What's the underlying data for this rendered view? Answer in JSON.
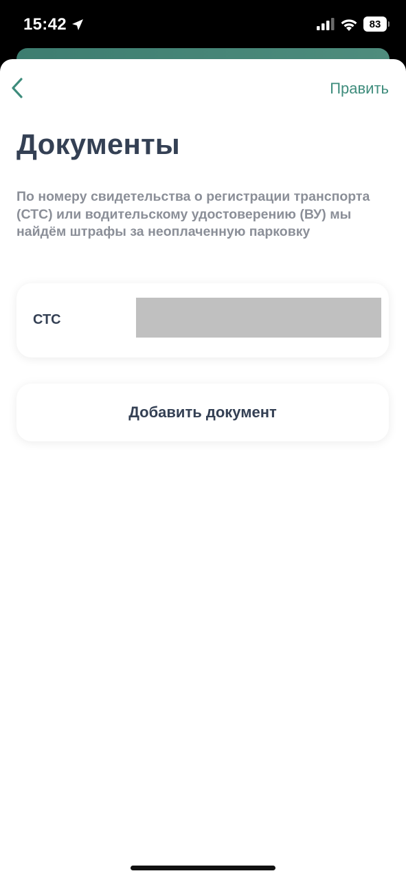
{
  "status_bar": {
    "time": "15:42",
    "battery": "83",
    "icons": [
      "location-arrow-icon",
      "cellular-signal-icon",
      "wifi-icon",
      "battery-icon"
    ]
  },
  "nav": {
    "back_icon": "chevron-left-icon",
    "edit_label": "Править"
  },
  "page": {
    "title": "Документы",
    "description": "По номеру свидетельства о регистрации транспорта (СТС) или водительскому удостоверению (ВУ) мы найдём штрафы за неоплаченную парковку"
  },
  "documents": [
    {
      "label": "СТС",
      "value": ""
    }
  ],
  "add_document_label": "Добавить документ",
  "colors": {
    "accent": "#3e8c7c",
    "title": "#344054",
    "description": "#8b8f98",
    "redacted": "#c0c0c0"
  }
}
